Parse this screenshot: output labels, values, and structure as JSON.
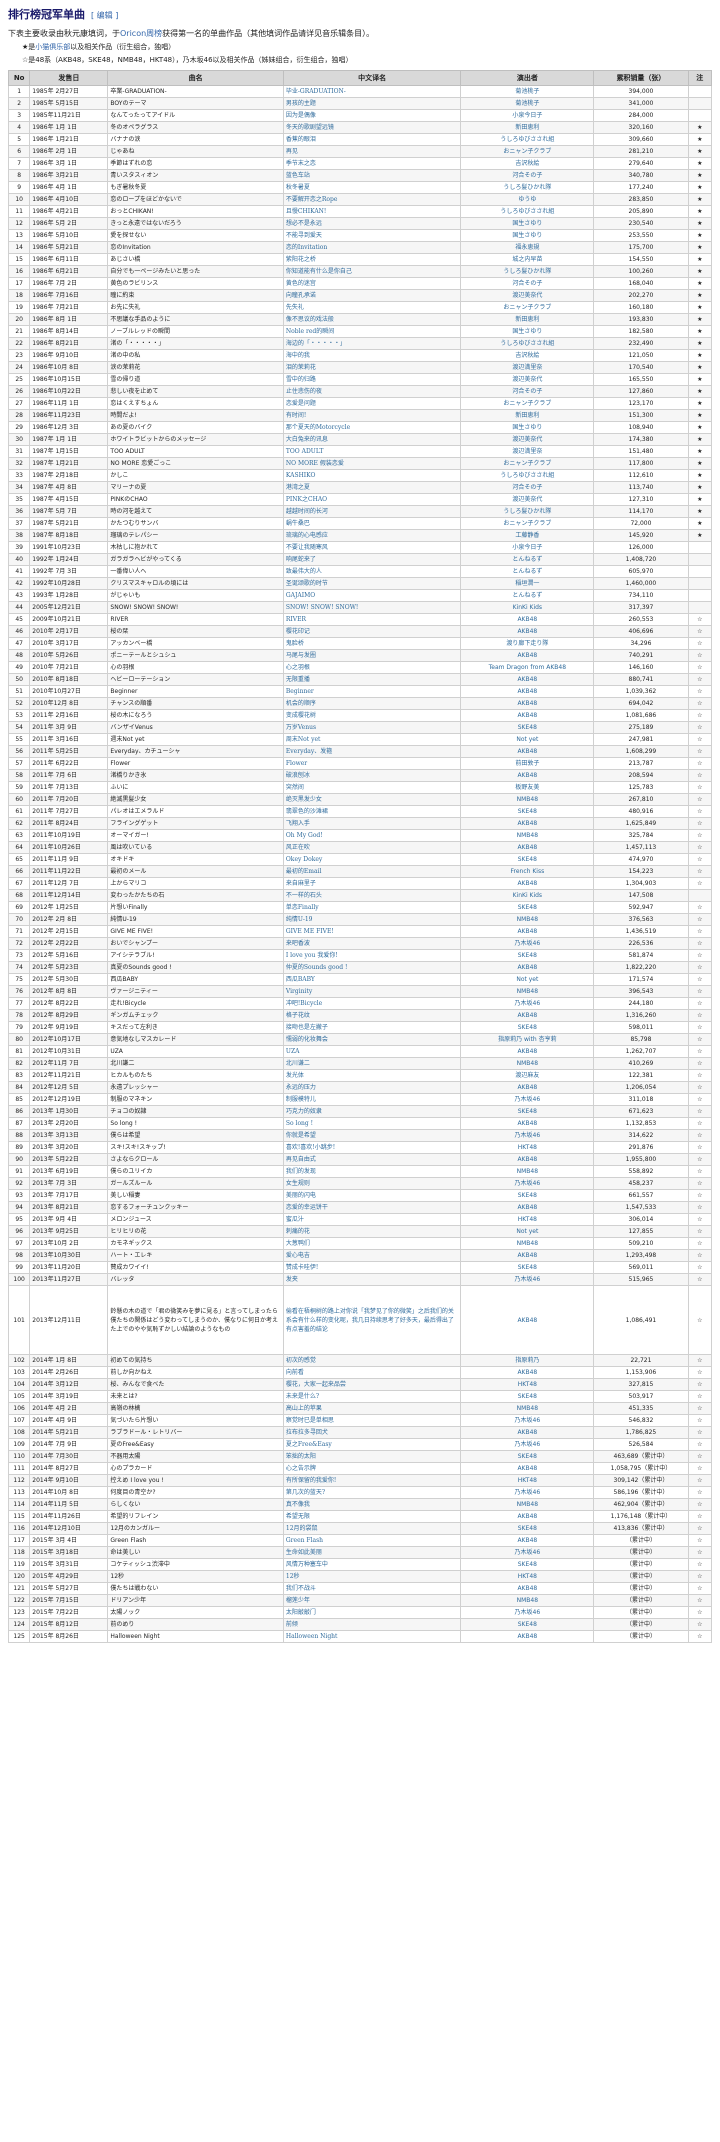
{
  "page": {
    "title": "排行榜冠军单曲",
    "edit_label": "[ 编辑 ]",
    "intro_a": "下表主要收录由秋元康填词，于",
    "intro_link": "Oricon周榜",
    "intro_b": "获得第一名的单曲作品（其他填词作品请详见音乐辑条目）。",
    "note1_mark": "★是",
    "note1_link": "小猫俱乐部",
    "note1_rest": "以及相关作品（衍生组合，独唱）",
    "note2": "☆是48系（AKB48，SKE48，NMB48，HKT48），乃木坂46以及相关作品（姊妹组合，衍生组合，独唱）"
  },
  "columns": [
    "No",
    "发售日",
    "曲名",
    "中文译名",
    "演出者",
    "累积销量（张）",
    "注"
  ],
  "rows": [
    [
      "1",
      "1985年 2月27日",
      "卒業-GRADUATION-",
      "毕业-GRADUATION-",
      "菊池桃子",
      "394,000",
      ""
    ],
    [
      "2",
      "1985年 5月15日",
      "BOYのテーマ",
      "男孩的主题",
      "菊池桃子",
      "341,000",
      ""
    ],
    [
      "3",
      "1985年11月21日",
      "なんてったってアイドル",
      "因为是偶像",
      "小泉今日子",
      "284,000",
      ""
    ],
    [
      "4",
      "1986年 1月 1日",
      "冬のオペラグラス",
      "冬天的歌剧望远镜",
      "新田恵利",
      "320,160",
      "★"
    ],
    [
      "5",
      "1986年 1月21日",
      "バナナの涙",
      "香蕉的眼泪",
      "うしろゆびさされ組",
      "309,660",
      "★"
    ],
    [
      "6",
      "1986年 2月 1日",
      "じゃあね",
      "再见",
      "おニャン子クラブ",
      "281,210",
      "★"
    ],
    [
      "7",
      "1986年 3月 1日",
      "季節はずれの恋",
      "季节末之恋",
      "吉沢秋絵",
      "279,640",
      "★"
    ],
    [
      "8",
      "1986年 3月21日",
      "青いスタスィオン",
      "蓝色车站",
      "河合その子",
      "340,780",
      "★"
    ],
    [
      "9",
      "1986年 4月 1日",
      "もぎ暑秋冬夏",
      "秋冬暑夏",
      "うしろ髪ひかれ隊",
      "177,240",
      "★"
    ],
    [
      "10",
      "1986年 4月10日",
      "恋のロープをほどかないで",
      "不要解开恋之Rope",
      "ゆうゆ",
      "283,850",
      "★"
    ],
    [
      "11",
      "1986年 4月21日",
      "おっとCHIKAN!",
      "且慢CHIKAN!",
      "うしろゆびさされ組",
      "205,890",
      "★"
    ],
    [
      "12",
      "1986年 5月 2日",
      "きっと永遠ではないだろう",
      "想必不是永远",
      "国生さゆり",
      "230,540",
      "★"
    ],
    [
      "13",
      "1986年 5月10日",
      "愛を探せない",
      "不能寻到爱天",
      "国生さゆり",
      "253,550",
      "★"
    ],
    [
      "14",
      "1986年 5月21日",
      "恋のInvitation",
      "恋的Invitation",
      "福永恵規",
      "175,700",
      "★"
    ],
    [
      "15",
      "1986年 6月11日",
      "あじさい橋",
      "紫阳花之桥",
      "城之内早苗",
      "154,550",
      "★"
    ],
    [
      "16",
      "1986年 6月21日",
      "自分でも一ページみたいと思った",
      "你知道能有什么是你自己",
      "うしろ髪ひかれ隊",
      "100,260",
      "★"
    ],
    [
      "17",
      "1986年 7月 2日",
      "黄色のラビリンス",
      "黄色的迷宫",
      "河合その子",
      "168,040",
      "★"
    ],
    [
      "18",
      "1986年 7月16日",
      "瞳に約束",
      "向瞳孔承诺",
      "渡辺美奈代",
      "202,270",
      "★"
    ],
    [
      "19",
      "1986年 7月21日",
      "お先に失礼",
      "先失礼",
      "おニャン子クラブ",
      "160,180",
      "★"
    ],
    [
      "20",
      "1986年 8月 1日",
      "不思議な手品のように",
      "像不思议的戏法般",
      "新田恵利",
      "193,830",
      "★"
    ],
    [
      "21",
      "1986年 8月14日",
      "ノーブルレッドの瞬間",
      "Noble red的瞬间",
      "国生さゆり",
      "182,580",
      "★"
    ],
    [
      "22",
      "1986年 8月21日",
      "渚の「・・・・・」",
      "海边的「・・・・・」",
      "うしろゆびさされ組",
      "232,490",
      "★"
    ],
    [
      "23",
      "1986年 9月10日",
      "渚の中の私",
      "海中的我",
      "吉沢秋絵",
      "121,050",
      "★"
    ],
    [
      "24",
      "1986年10月 8日",
      "涙の茉莉花",
      "泪的茉莉花",
      "渡辺満里奈",
      "170,540",
      "★"
    ],
    [
      "25",
      "1986年10月15日",
      "雪の帰り道",
      "雪中的归路",
      "渡辺美奈代",
      "165,550",
      "★"
    ],
    [
      "26",
      "1986年10月22日",
      "悲しい夜を止めて",
      "止住悲伤的夜",
      "河合その子",
      "127,860",
      "★"
    ],
    [
      "27",
      "1986年11月 1日",
      "恋はくえすちょん",
      "恋爱是问题",
      "おニャン子クラブ",
      "123,170",
      "★"
    ],
    [
      "28",
      "1986年11月23日",
      "時間だよ!",
      "有时间!",
      "新田恵利",
      "151,300",
      "★"
    ],
    [
      "29",
      "1986年12月 3日",
      "あの夏のバイク",
      "那个夏天的Motorcycle",
      "国生さゆり",
      "108,940",
      "★"
    ],
    [
      "30",
      "1987年 1月 1日",
      "ホワイトラビットからのメッセージ",
      "大白兔来的讯息",
      "渡辺美奈代",
      "174,380",
      "★"
    ],
    [
      "31",
      "1987年 1月15日",
      "TOO ADULT",
      "TOO ADULT",
      "渡辺満里奈",
      "151,480",
      "★"
    ],
    [
      "32",
      "1987年 1月21日",
      "NO MORE 恋愛ごっこ",
      "NO MORE 假装恋爱",
      "おニャン子クラブ",
      "117,800",
      "★"
    ],
    [
      "33",
      "1987年 2月18日",
      "かしこ",
      "KASHIKO",
      "うしろゆびさされ組",
      "112,610",
      "★"
    ],
    [
      "34",
      "1987年 4月 8日",
      "マリーナの夏",
      "港湾之夏",
      "河合その子",
      "113,740",
      "★"
    ],
    [
      "35",
      "1987年 4月15日",
      "PINKのCHAO",
      "PINK之CHAO",
      "渡辺美奈代",
      "127,310",
      "★"
    ],
    [
      "36",
      "1987年 5月 7日",
      "時の河を越えて",
      "越越时间的长河",
      "うしろ髪ひかれ隊",
      "114,170",
      "★"
    ],
    [
      "37",
      "1987年 5月21日",
      "かたつむりサンバ",
      "蜗牛桑巴",
      "おニャン子クラブ",
      "72,000",
      "★"
    ],
    [
      "38",
      "1987年 8月18日",
      "瑠璃のテレパシー",
      "琉璃的心电感应",
      "工藤静香",
      "145,920",
      "★"
    ],
    [
      "39",
      "1991年10月23日",
      "木枯しに抱かれて",
      "不要让我随寒风",
      "小泉今日子",
      "126,000",
      ""
    ],
    [
      "40",
      "1992年 1月24日",
      "ガラガラヘビがやってくる",
      "响尾蛇来了",
      "とんねるず",
      "1,408,720",
      ""
    ],
    [
      "41",
      "1992年 7月 3日",
      "一番偉い人へ",
      "致最伟大的人",
      "とんねるず",
      "605,970",
      ""
    ],
    [
      "42",
      "1992年10月28日",
      "クリスマスキャロルの頃には",
      "圣诞颂歌的时节",
      "稲垣潤一",
      "1,460,000",
      ""
    ],
    [
      "43",
      "1993年 1月28日",
      "がじゃいも",
      "GAJAIMO",
      "とんねるず",
      "734,110",
      ""
    ],
    [
      "44",
      "2005年12月21日",
      "SNOW! SNOW! SNOW!",
      "SNOW! SNOW! SNOW!",
      "KinKi Kids",
      "317,397",
      ""
    ],
    [
      "45",
      "2009年10月21日",
      "RIVER",
      "RIVER",
      "AKB48",
      "260,553",
      "☆"
    ],
    [
      "46",
      "2010年 2月17日",
      "桜の栞",
      "樱花印记",
      "AKB48",
      "406,696",
      "☆"
    ],
    [
      "47",
      "2010年 3月17日",
      "アッカンベー橋",
      "鬼脸桥",
      "渡り廊下走り隊",
      "34,296",
      "☆"
    ],
    [
      "48",
      "2010年 5月26日",
      "ポニーテールとシュシュ",
      "马尾与发圈",
      "AKB48",
      "740,291",
      "☆"
    ],
    [
      "49",
      "2010年 7月21日",
      "心の羽根",
      "心之羽根",
      "Team Dragon from AKB48",
      "146,160",
      "☆"
    ],
    [
      "50",
      "2010年 8月18日",
      "ヘビーローテーション",
      "无限重播",
      "AKB48",
      "880,741",
      "☆"
    ],
    [
      "51",
      "2010年10月27日",
      "Beginner",
      "Beginner",
      "AKB48",
      "1,039,362",
      "☆"
    ],
    [
      "52",
      "2010年12月 8日",
      "チャンスの順番",
      "机会的顺序",
      "AKB48",
      "694,042",
      "☆"
    ],
    [
      "53",
      "2011年 2月16日",
      "桜の木になろう",
      "变成樱花树",
      "AKB48",
      "1,081,686",
      "☆"
    ],
    [
      "54",
      "2011年 3月 9日",
      "バンザイVenus",
      "万岁Venus",
      "SKE48",
      "275,189",
      "☆"
    ],
    [
      "55",
      "2011年 3月16日",
      "週末Not yet",
      "周末Not yet",
      "Not yet",
      "247,981",
      "☆"
    ],
    [
      "56",
      "2011年 5月25日",
      "Everyday、カチューシャ",
      "Everyday、发箍",
      "AKB48",
      "1,608,299",
      "☆"
    ],
    [
      "57",
      "2011年 6月22日",
      "Flower",
      "Flower",
      "前田敦子",
      "213,787",
      "☆"
    ],
    [
      "58",
      "2011年 7月 6日",
      "渚橋りかき氷",
      "破浪刨冰",
      "AKB48",
      "208,594",
      "☆"
    ],
    [
      "59",
      "2011年 7月13日",
      "ふいに",
      "突然间",
      "板野友美",
      "125,783",
      "☆"
    ],
    [
      "60",
      "2011年 7月20日",
      "絶滅黒髪少女",
      "绝灭黑发少女",
      "NMB48",
      "267,810",
      "☆"
    ],
    [
      "61",
      "2011年 7月27日",
      "パレオはエメラルド",
      "翡翠色的沙滩裙",
      "SKE48",
      "480,916",
      "☆"
    ],
    [
      "62",
      "2011年 8月24日",
      "フライングゲット",
      "飞翔入手",
      "AKB48",
      "1,625,849",
      "☆"
    ],
    [
      "63",
      "2011年10月19日",
      "オーマイガー!",
      "Oh My God!",
      "NMB48",
      "325,784",
      "☆"
    ],
    [
      "64",
      "2011年10月26日",
      "風は吹いている",
      "风正在吹",
      "AKB48",
      "1,457,113",
      "☆"
    ],
    [
      "65",
      "2011年11月 9日",
      "オキドキ",
      "Okey Dokey",
      "SKE48",
      "474,970",
      "☆"
    ],
    [
      "66",
      "2011年11月22日",
      "最初のメール",
      "最初的Email",
      "French Kiss",
      "154,223",
      "☆"
    ],
    [
      "67",
      "2011年12月 7日",
      "上からマリコ",
      "来自麻里子",
      "AKB48",
      "1,304,903",
      "☆"
    ],
    [
      "68",
      "2011年12月14日",
      "変わったかたちの石",
      "不一样的石头",
      "KinKi Kids",
      "147,508",
      ""
    ],
    [
      "69",
      "2012年 1月25日",
      "片想いFinally",
      "单恋Finally",
      "SKE48",
      "592,947",
      "☆"
    ],
    [
      "70",
      "2012年 2月 8日",
      "純情U-19",
      "纯情U-19",
      "NMB48",
      "376,563",
      "☆"
    ],
    [
      "71",
      "2012年 2月15日",
      "GIVE ME FIVE!",
      "GIVE ME FIVE!",
      "AKB48",
      "1,436,519",
      "☆"
    ],
    [
      "72",
      "2012年 2月22日",
      "おいでシャンプー",
      "来吧香波",
      "乃木坂46",
      "226,536",
      "☆"
    ],
    [
      "73",
      "2012年 5月16日",
      "アイシテラブル!",
      "I love you 我爱你!",
      "SKE48",
      "581,874",
      "☆"
    ],
    [
      "74",
      "2012年 5月23日",
      "真夏のSounds good !",
      "仲夏的Sounds good !",
      "AKB48",
      "1,822,220",
      "☆"
    ],
    [
      "75",
      "2012年 5月30日",
      "西瓜BABY",
      "西瓜BABY",
      "Not yet",
      "171,574",
      "☆"
    ],
    [
      "76",
      "2012年 8月 8日",
      "ヴァージニティー",
      "Virginity",
      "NMB48",
      "396,543",
      "☆"
    ],
    [
      "77",
      "2012年 8月22日",
      "走れ!Bicycle",
      "冲吧!Bicycle",
      "乃木坂46",
      "244,180",
      "☆"
    ],
    [
      "78",
      "2012年 8月29日",
      "ギンガムチェック",
      "格子花纹",
      "AKB48",
      "1,316,260",
      "☆"
    ],
    [
      "79",
      "2012年 9月19日",
      "キスだって左利き",
      "接吻也是左撇子",
      "SKE48",
      "598,011",
      "☆"
    ],
    [
      "80",
      "2012年10月17日",
      "意気地なしマスカレード",
      "懦弱的化妆舞会",
      "指原莉乃 with 杏亨莉",
      "85,798",
      "☆"
    ],
    [
      "81",
      "2012年10月31日",
      "UZA",
      "UZA",
      "AKB48",
      "1,262,707",
      "☆"
    ],
    [
      "82",
      "2012年11月 7日",
      "北川謙二",
      "北川谦二",
      "NMB48",
      "410,269",
      "☆"
    ],
    [
      "83",
      "2012年11月21日",
      "ヒカルものたち",
      "发光体",
      "渡辺麻友",
      "122,381",
      "☆"
    ],
    [
      "84",
      "2012年12月 5日",
      "永遠プレッシャー",
      "永远的压力",
      "AKB48",
      "1,206,054",
      "☆"
    ],
    [
      "85",
      "2012年12月19日",
      "制服のマネキン",
      "制服模特儿",
      "乃木坂46",
      "311,018",
      "☆"
    ],
    [
      "86",
      "2013年 1月30日",
      "チョコの奴隷",
      "巧克力的奴隶",
      "SKE48",
      "671,623",
      "☆"
    ],
    [
      "87",
      "2013年 2月20日",
      "So long !",
      "So long !",
      "AKB48",
      "1,132,853",
      "☆"
    ],
    [
      "88",
      "2013年 3月13日",
      "僕らは希望",
      "你就是希望",
      "乃木坂46",
      "314,622",
      "☆"
    ],
    [
      "89",
      "2013年 3月20日",
      "スキ!スキ!スキップ!",
      "喜欢!喜欢!小跳步!",
      "HKT48",
      "291,876",
      "☆"
    ],
    [
      "90",
      "2013年 5月22日",
      "さよならクロール",
      "再见自由式",
      "AKB48",
      "1,955,800",
      "☆"
    ],
    [
      "91",
      "2013年 6月19日",
      "僕らのユリイカ",
      "我们的发现",
      "NMB48",
      "558,892",
      "☆"
    ],
    [
      "92",
      "2013年 7月 3日",
      "ガールズルール",
      "女生规则",
      "乃木坂46",
      "458,237",
      "☆"
    ],
    [
      "93",
      "2013年 7月17日",
      "美しい稲妻",
      "美丽的闪电",
      "SKE48",
      "661,557",
      "☆"
    ],
    [
      "94",
      "2013年 8月21日",
      "恋するフォーチュンクッキー",
      "恋爱的幸运饼干",
      "AKB48",
      "1,547,533",
      "☆"
    ],
    [
      "95",
      "2013年 9月 4日",
      "メロンジュース",
      "蜜瓜汁",
      "HKT48",
      "306,014",
      "☆"
    ],
    [
      "96",
      "2013年 9月25日",
      "ヒリヒリの花",
      "刺痛的花",
      "Not yet",
      "127,855",
      "☆"
    ],
    [
      "97",
      "2013年10月 2日",
      "カモネギックス",
      "大葱鸭们",
      "NMB48",
      "509,210",
      "☆"
    ],
    [
      "98",
      "2013年10月30日",
      "ハート・エレキ",
      "爱心电吉",
      "AKB48",
      "1,293,498",
      "☆"
    ],
    [
      "99",
      "2013年11月20日",
      "賛成カワイイ!",
      "赞成卡哇伊!",
      "SKE48",
      "569,011",
      "☆"
    ],
    [
      "100",
      "2013年11月27日",
      "バレッタ",
      "发夹",
      "乃木坂46",
      "515,965",
      "☆"
    ]
  ],
  "tall_row": {
    "no": "101",
    "date": "2013年12月11日",
    "jp": "鈴懸の木の道で「君の微笑みを夢に見る」と言ってしまったら僕たちの関係はどう変わってしまうのか、僕なりに何日か考えた上でのやや気恥ずかしい結論のようなもの",
    "cn": "偷看在梧桐树的路上对你说「我梦见了你的微笑」之后我们的关系会有什么样的变化呢，我几日持续思考了好多天，最后得出了有点害羞的结论",
    "artist": "AKB48",
    "sales": "1,086,491",
    "note": "☆"
  },
  "rows2": [
    [
      "102",
      "2014年 1月 8日",
      "初めての気持ち",
      "初次的感觉",
      "指原莉乃",
      "22,721",
      "☆"
    ],
    [
      "103",
      "2014年 2月26日",
      "前しか向かねえ",
      "向前看",
      "AKB48",
      "1,153,906",
      "☆"
    ],
    [
      "104",
      "2014年 3月12日",
      "桜、みんなで食べた",
      "樱花，大家一起来品尝",
      "HKT48",
      "327,815",
      "☆"
    ],
    [
      "105",
      "2014年 3月19日",
      "未来とは?",
      "未来是什么?",
      "SKE48",
      "503,917",
      "☆"
    ],
    [
      "106",
      "2014年 4月 2日",
      "高嶺の林檎",
      "高山上的苹果",
      "NMB48",
      "451,335",
      "☆"
    ],
    [
      "107",
      "2014年 4月 9日",
      "気づいたら片想い",
      "察觉时已是单相思",
      "乃木坂46",
      "546,832",
      "☆"
    ],
    [
      "108",
      "2014年 5月21日",
      "ラブラドール・レトリバー",
      "拉布拉多寻回犬",
      "AKB48",
      "1,786,825",
      "☆"
    ],
    [
      "109",
      "2014年 7月 9日",
      "夏のFree&Easy",
      "夏之Free&Easy",
      "乃木坂46",
      "526,584",
      "☆"
    ],
    [
      "110",
      "2014年 7月30日",
      "不器用太陽",
      "笨拙的太阳",
      "SKE48",
      "463,689（累计中）",
      "☆"
    ],
    [
      "111",
      "2014年 8月27日",
      "心のプラカード",
      "心之告示牌",
      "AKB48",
      "1,058,795（累计中）",
      "☆"
    ],
    [
      "112",
      "2014年 9月10日",
      "控えめ I love you !",
      "有所保留的我爱你!",
      "HKT48",
      "309,142（累计中）",
      "☆"
    ],
    [
      "113",
      "2014年10月 8日",
      "何度目の青空か?",
      "第几次的蓝天?",
      "乃木坂46",
      "586,196（累计中）",
      "☆"
    ],
    [
      "114",
      "2014年11月 5日",
      "らしくない",
      "真不像我",
      "NMB48",
      "462,904（累计中）",
      "☆"
    ],
    [
      "115",
      "2014年11月26日",
      "希望的リフレイン",
      "希望无限",
      "AKB48",
      "1,176,148（累计中）",
      "☆"
    ],
    [
      "116",
      "2014年12月10日",
      "12月のカンガルー",
      "12月的袋鼠",
      "SKE48",
      "413,836（累计中）",
      "☆"
    ],
    [
      "117",
      "2015年 3月 4日",
      "Green Flash",
      "Green Flash",
      "AKB48",
      "（累计中）",
      "☆"
    ],
    [
      "118",
      "2015年 3月18日",
      "命は美しい",
      "生命如此美丽",
      "乃木坂46",
      "（累计中）",
      "☆"
    ],
    [
      "119",
      "2015年 3月31日",
      "コケティッシュ渋滞中",
      "风情万种塞车中",
      "SKE48",
      "（累计中）",
      "☆"
    ],
    [
      "120",
      "2015年 4月29日",
      "12秒",
      "12秒",
      "HKT48",
      "（累计中）",
      "☆"
    ],
    [
      "121",
      "2015年 5月27日",
      "僕たちは戦わない",
      "我们不战斗",
      "AKB48",
      "（累计中）",
      "☆"
    ],
    [
      "122",
      "2015年 7月15日",
      "ドリアン少年",
      "榴莲少年",
      "NMB48",
      "（累计中）",
      "☆"
    ],
    [
      "123",
      "2015年 7月22日",
      "太陽ノック",
      "太阳敲敲门",
      "乃木坂46",
      "（累计中）",
      "☆"
    ],
    [
      "124",
      "2015年 8月12日",
      "前のめり",
      "前倾",
      "SKE48",
      "（累计中）",
      "☆"
    ],
    [
      "125",
      "2015年 8月26日",
      "Halloween Night",
      "Halloween Night",
      "AKB48",
      "（累计中）",
      "☆"
    ]
  ]
}
